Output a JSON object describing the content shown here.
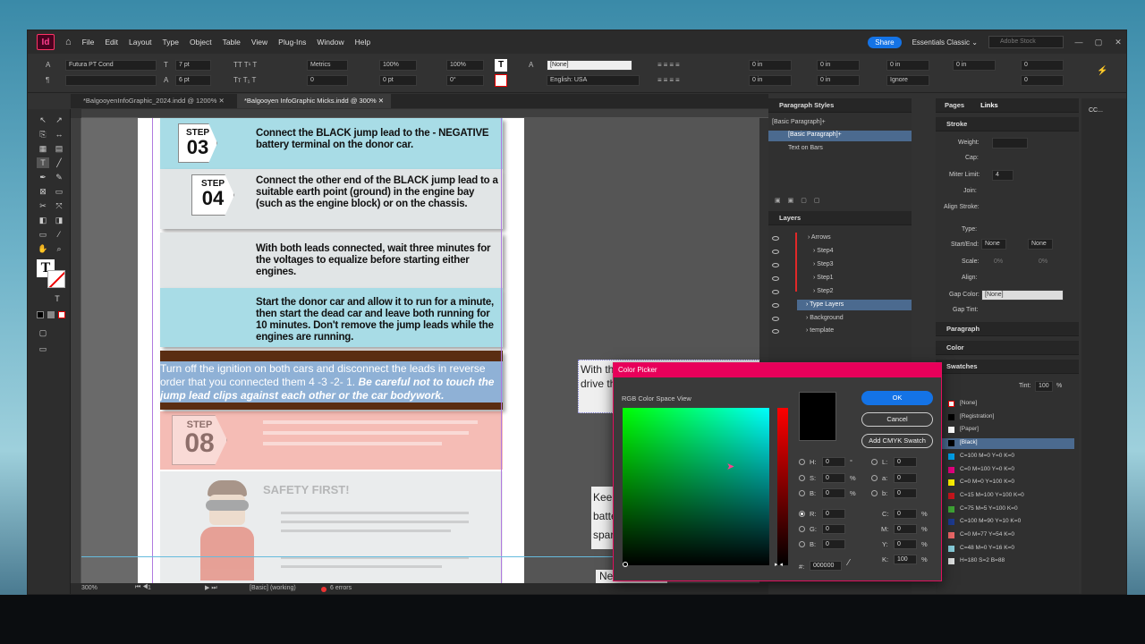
{
  "app": {
    "logo": "Id",
    "menu": [
      "File",
      "Edit",
      "Layout",
      "Type",
      "Object",
      "Table",
      "View",
      "Plug-Ins",
      "Window",
      "Help"
    ],
    "share": "Share",
    "workspace": "Essentials Classic",
    "search_placeholder": "Adobe Stock"
  },
  "control": {
    "font": "Futura PT Cond",
    "size": "7 pt",
    "leading": "6 pt",
    "kerning": "Metrics",
    "vscale": "100%",
    "hscale": "100%",
    "tracking": "0",
    "baseline": "0 pt",
    "skew": "0°",
    "char_style": "[None]",
    "language": "English: USA",
    "indent1": "0 in",
    "indent2": "0 in",
    "indent3": "0 in",
    "indent4": "0 in",
    "space1": "0 in",
    "space2": "0 in",
    "drop1": "0",
    "drop2": "0",
    "ignore": "Ignore"
  },
  "tabs": [
    "*BalgooyenInfoGraphic_2024.indd @ 1200%",
    "*Balgooyen InfoGraphic Micks.indd @ 300%"
  ],
  "doc": {
    "step03_label": "STEP",
    "step03_num": "03",
    "step03_text": "Connect the BLACK jump lead to the - NEGATIVE battery terminal on the donor car.",
    "step04_label": "STEP",
    "step04_num": "04",
    "step04_text": "Connect the other end of the BLACK jump lead to a suitable earth point (ground) in the engine bay (such as the engine block) or on the chassis.",
    "step05_text": "With both leads connected, wait three minutes for the voltages to equalize before starting either engines.",
    "step06_text": "Start the donor car and allow it to run for a minute, then start the dead car and leave both running for 10 minutes. Don't remove the jump leads while the engines are running.",
    "step07_text1": "Turn off the ignition on both cars and disconnect the leads in reverse order that you connected them 4 -3 -2- 1.",
    "step07_text2": "Be careful not to touch the jump lead clips against each other or the car bodywork.",
    "step08_label": "STEP",
    "step08_num": "08",
    "safety": "SAFETY FIRST!",
    "side1": "With the jump lead…",
    "side2": "drive the car f…",
    "side3": "Keep metal…",
    "side4": "battery ter…",
    "side5": "spark or e…",
    "side6": "Never att…"
  },
  "status": {
    "zoom": "300%",
    "page": "1",
    "style": "[Basic] (working)",
    "errors": "6 errors"
  },
  "para_styles": {
    "title": "Paragraph Styles",
    "current": "[Basic Paragraph]+",
    "items": [
      "[Basic Paragraph]+",
      "Text on Bars"
    ]
  },
  "layers": {
    "title": "Layers",
    "items": [
      "Arrows",
      "Step4",
      "Step3",
      "Step1",
      "Step2",
      "Type Layers",
      "Background",
      "template"
    ]
  },
  "right_panels": {
    "tab_pages": "Pages",
    "tab_links": "Links",
    "stroke": "Stroke",
    "weight": "Weight:",
    "cap": "Cap:",
    "miter": "Miter Limit:",
    "miter_val": "4",
    "join": "Join:",
    "align_stroke": "Align Stroke:",
    "type": "Type:",
    "start_end": "Start/End:",
    "none1": "None",
    "none2": "None",
    "scale": "Scale:",
    "scale1": "0%",
    "scale2": "0%",
    "align": "Align:",
    "gap_color": "Gap Color:",
    "gap_color_val": "[None]",
    "gap_tint": "Gap Tint:",
    "paragraph": "Paragraph",
    "color": "Color",
    "swatches": "Swatches",
    "tint": "Tint:",
    "tint_val": "100",
    "tint_unit": "%",
    "cc": "CC..."
  },
  "swatches": [
    {
      "name": "[None]",
      "color": "#ffffff"
    },
    {
      "name": "[Registration]",
      "color": "#000000"
    },
    {
      "name": "[Paper]",
      "color": "#ffffff"
    },
    {
      "name": "[Black]",
      "color": "#000000"
    },
    {
      "name": "C=100 M=0 Y=0 K=0",
      "color": "#00a0e9"
    },
    {
      "name": "C=0 M=100 Y=0 K=0",
      "color": "#e4007f"
    },
    {
      "name": "C=0 M=0 Y=100 K=0",
      "color": "#fff100"
    },
    {
      "name": "C=15 M=100 Y=100 K=0",
      "color": "#c8161d"
    },
    {
      "name": "C=75 M=5 Y=100 K=0",
      "color": "#3fa535"
    },
    {
      "name": "C=100 M=90 Y=10 K=0",
      "color": "#1d3a8f"
    },
    {
      "name": "C=0 M=77 Y=54 K=0",
      "color": "#ec6868"
    },
    {
      "name": "C=48 M=0 Y=16 K=0",
      "color": "#87cedb"
    },
    {
      "name": "H=180 S=2 B=88",
      "color": "#dde0e0"
    }
  ],
  "color_picker": {
    "title": "Color Picker",
    "view": "RGB Color Space View",
    "ok": "OK",
    "cancel": "Cancel",
    "add_cmyk": "Add CMYK Swatch",
    "h": "0",
    "s": "0",
    "b": "0",
    "r": "0",
    "g": "0",
    "bl": "0",
    "l": "0",
    "a": "0",
    "bb": "0",
    "c": "0",
    "m": "0",
    "y": "0",
    "k": "100",
    "hex": "000000",
    "deg": "°",
    "pct": "%"
  }
}
